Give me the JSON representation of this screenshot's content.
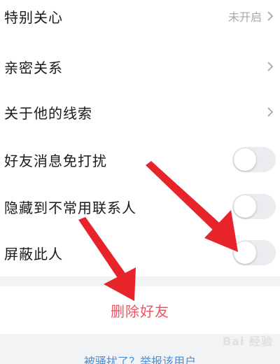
{
  "settings": {
    "special_care": {
      "label": "特别关心",
      "value": "未开启"
    },
    "intimacy": {
      "label": "亲密关系"
    },
    "clues": {
      "label": "关于他的线索"
    },
    "dnd": {
      "label": "好友消息免打扰",
      "enabled": false
    },
    "hide": {
      "label": "隐藏到不常用联系人",
      "enabled": false
    },
    "block": {
      "label": "屏蔽此人",
      "enabled": false
    }
  },
  "actions": {
    "delete_label": "删除好友",
    "report_label": "被骚扰了？举报该用户"
  },
  "watermark": {
    "text": "Bai 经验"
  },
  "colors": {
    "delete_red": "#f2525f",
    "link_blue": "#4a8fd8",
    "arrow_red": "#e8242b"
  }
}
